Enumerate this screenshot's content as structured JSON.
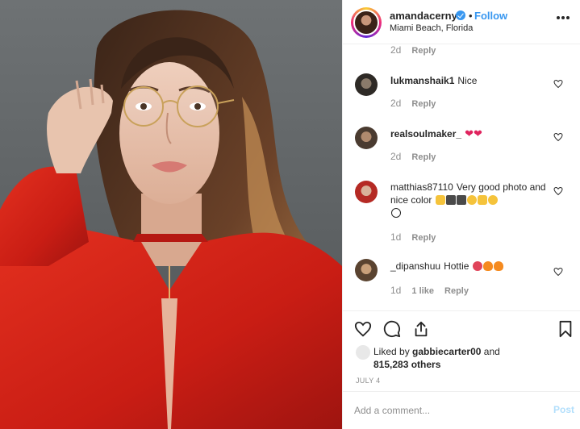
{
  "post": {
    "image_alt": "Woman in red leather jacket wearing round gold glasses"
  },
  "header": {
    "username": "amandacerny",
    "verified_icon": "verified-badge-icon",
    "separator": "•",
    "follow_label": "Follow",
    "location": "Miami Beach, Florida",
    "more_icon": "more-options-icon"
  },
  "comments": [
    {
      "username": "",
      "text": "",
      "time": "2d",
      "likes": "",
      "reply_label": "Reply"
    },
    {
      "username": "lukmanshaik1",
      "text": "Nice",
      "time": "2d",
      "likes": "",
      "reply_label": "Reply"
    },
    {
      "username": "realsoulmaker_",
      "text": "",
      "emojis": [
        "heart",
        "heart"
      ],
      "time": "2d",
      "likes": "",
      "reply_label": "Reply"
    },
    {
      "username": "matthias87110",
      "text": "Very good photo and nice color",
      "emojis": [
        "thumbs-up",
        "camera",
        "camera",
        "grin",
        "ok-hand",
        "smile",
        "smile"
      ],
      "time": "1d",
      "likes": "",
      "reply_label": "Reply"
    },
    {
      "username": "_dipanshuu",
      "text": "Hottie",
      "emojis": [
        "tongue-face",
        "fire",
        "fire"
      ],
      "time": "1d",
      "likes": "1 like",
      "reply_label": "Reply"
    }
  ],
  "actions": {
    "like_icon": "heart-outline-icon",
    "comment_icon": "comment-icon",
    "share_icon": "share-icon",
    "save_icon": "bookmark-icon"
  },
  "likes": {
    "prefix": "Liked by",
    "user": "gabbiecarter00",
    "and": "and",
    "others": "815,283 others"
  },
  "date": "JULY 4",
  "add_comment": {
    "placeholder": "Add a comment...",
    "post_label": "Post"
  },
  "colors": {
    "accent": "#3897f0",
    "post_disabled": "#b2dffc",
    "meta": "#8e8e8e",
    "jacket_red": "#d9261c"
  }
}
